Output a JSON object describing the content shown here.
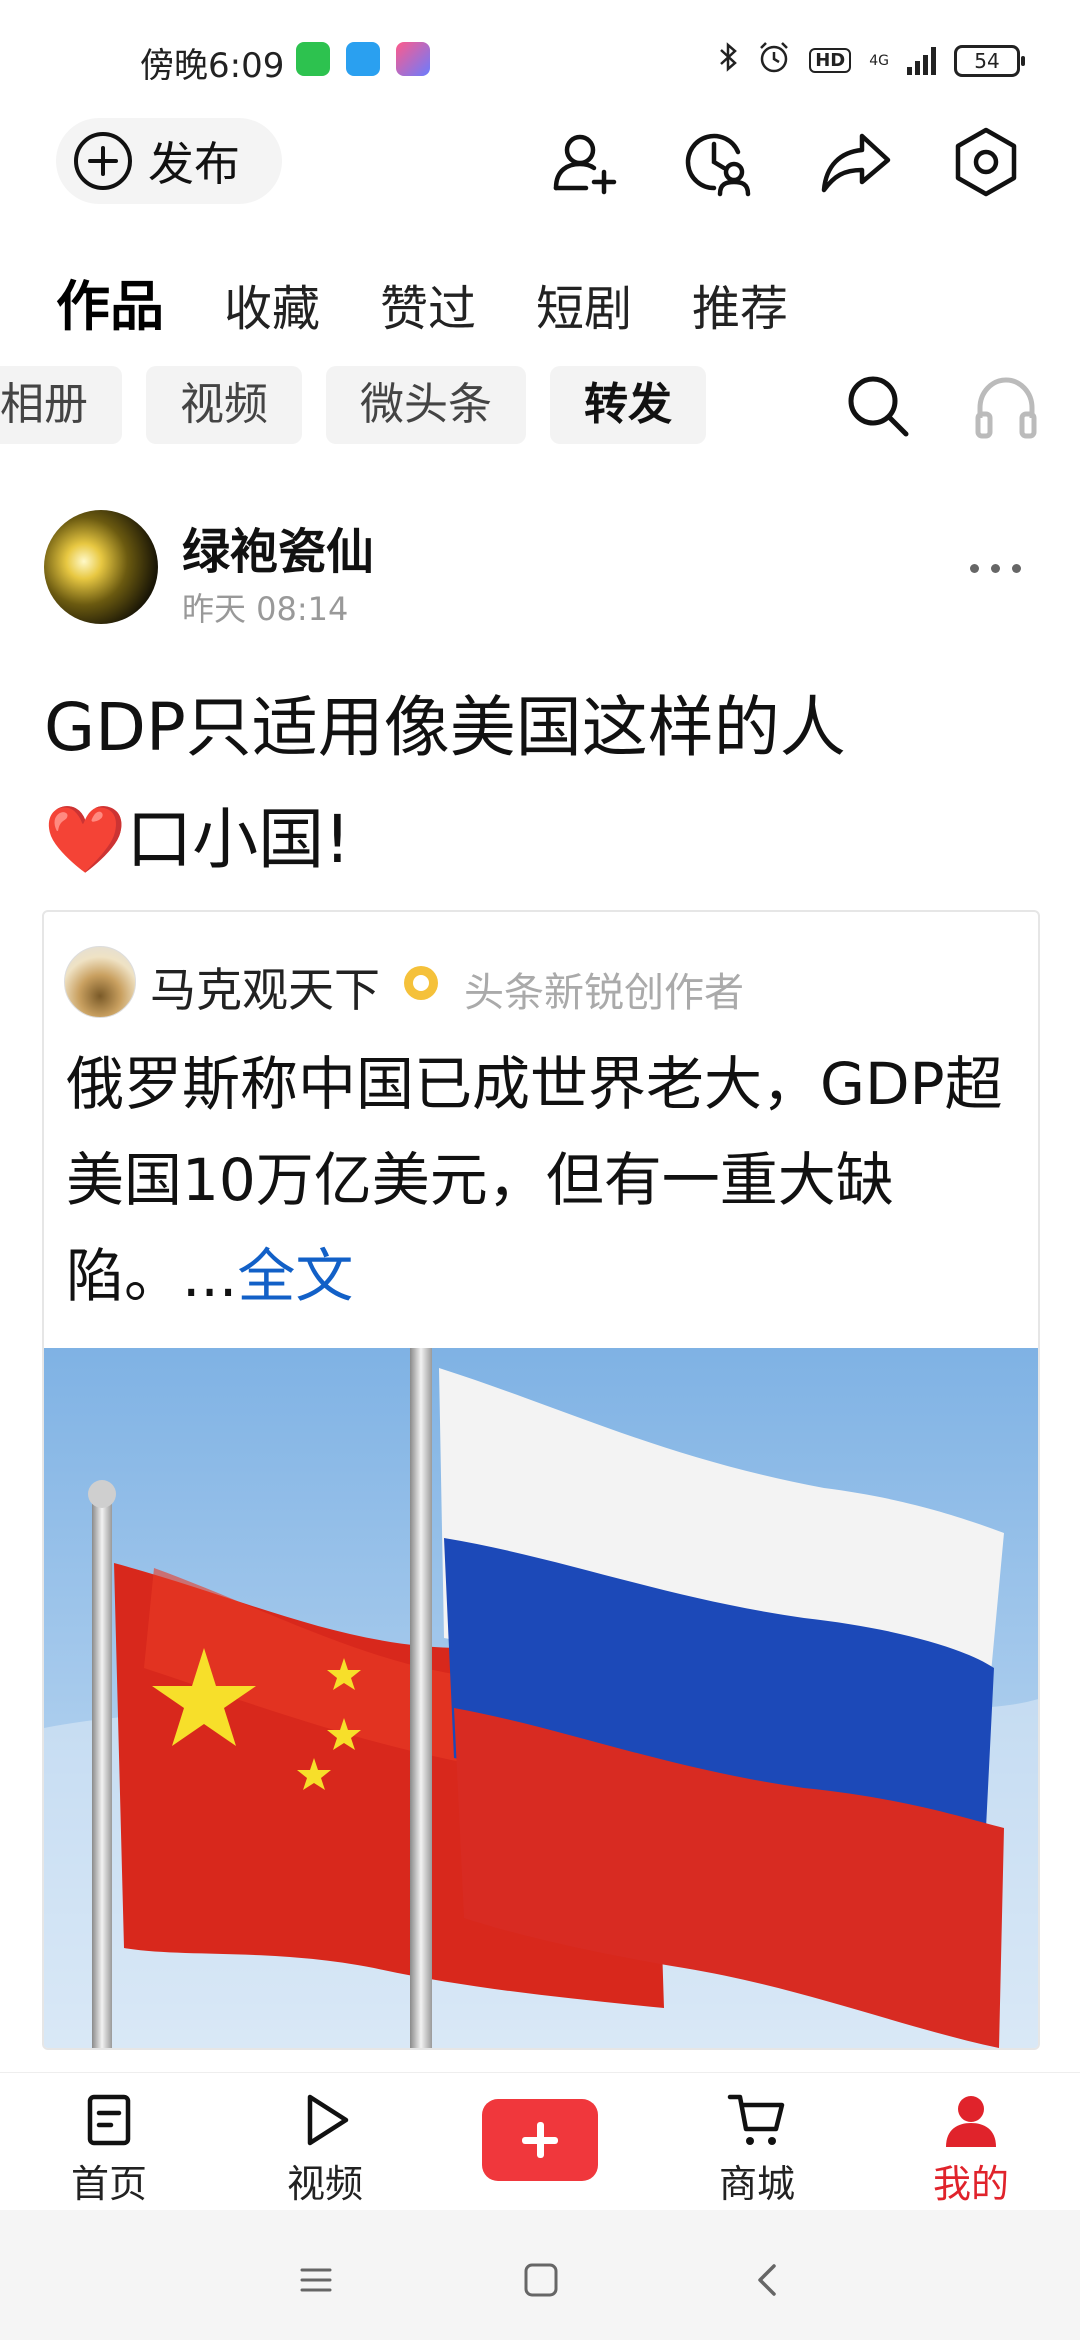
{
  "status_bar": {
    "time": "傍晚6:09",
    "hd": "HD",
    "network": "4G",
    "battery": "54"
  },
  "header": {
    "publish_label": "发布"
  },
  "tabs": [
    {
      "label": "作品",
      "active": true
    },
    {
      "label": "收藏",
      "active": false
    },
    {
      "label": "赞过",
      "active": false
    },
    {
      "label": "短剧",
      "active": false
    },
    {
      "label": "推荐",
      "active": false
    }
  ],
  "chips": [
    {
      "label": "相册",
      "active": false
    },
    {
      "label": "视频",
      "active": false
    },
    {
      "label": "微头条",
      "active": false
    },
    {
      "label": "转发",
      "active": true
    }
  ],
  "post": {
    "author": "绿袍瓷仙",
    "time": "昨天  08:14",
    "title_line1": "GDP只适用像美国这样的人",
    "heart": "❤️",
    "title_line2": "口小国!"
  },
  "quoted": {
    "author": "马克观天下",
    "tag": "头条新锐创作者",
    "text": "俄罗斯称中国已成世界老大，GDP超美国10万亿美元，但有一重大缺陷。...",
    "more": "全文"
  },
  "bottom_nav": [
    {
      "label": "首页",
      "icon": "home-doc-icon"
    },
    {
      "label": "视频",
      "icon": "play-icon"
    },
    {
      "label": "",
      "icon": "plus-icon"
    },
    {
      "label": "商城",
      "icon": "cart-icon"
    },
    {
      "label": "我的",
      "icon": "person-icon",
      "active": true
    }
  ],
  "colors": {
    "accent_red": "#f0373c",
    "active_nav": "#e0232b",
    "link_blue": "#1260c7",
    "muted_text": "#999999"
  }
}
